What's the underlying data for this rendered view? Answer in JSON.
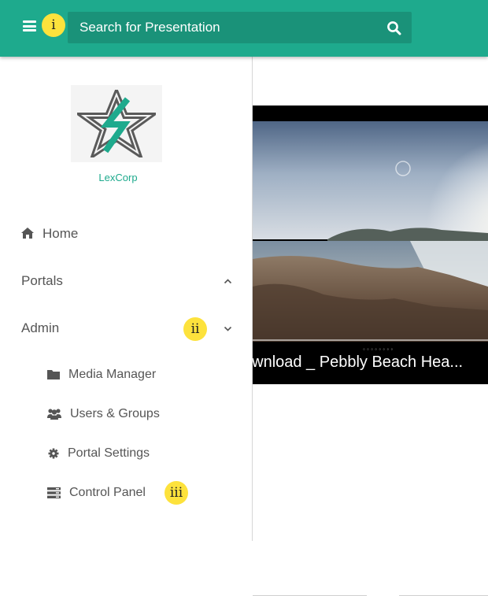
{
  "header": {
    "search_placeholder": "Search for Presentation",
    "badge_menu": "i"
  },
  "sidebar": {
    "org_name": "LexCorp",
    "nav": {
      "home": "Home",
      "portals": "Portals",
      "admin": "Admin",
      "admin_badge": "ii"
    },
    "admin_items": {
      "media_manager": "Media Manager",
      "users_groups": "Users & Groups",
      "portal_settings": "Portal Settings",
      "control_panel": "Control Panel",
      "control_panel_badge": "iii"
    }
  },
  "main": {
    "video_caption": "ownload _ Pebbly Beach Hea..."
  },
  "colors": {
    "brand": "#1eaa8d",
    "search_bg": "#1a9279",
    "badge": "#fde23c",
    "text": "#555555"
  }
}
